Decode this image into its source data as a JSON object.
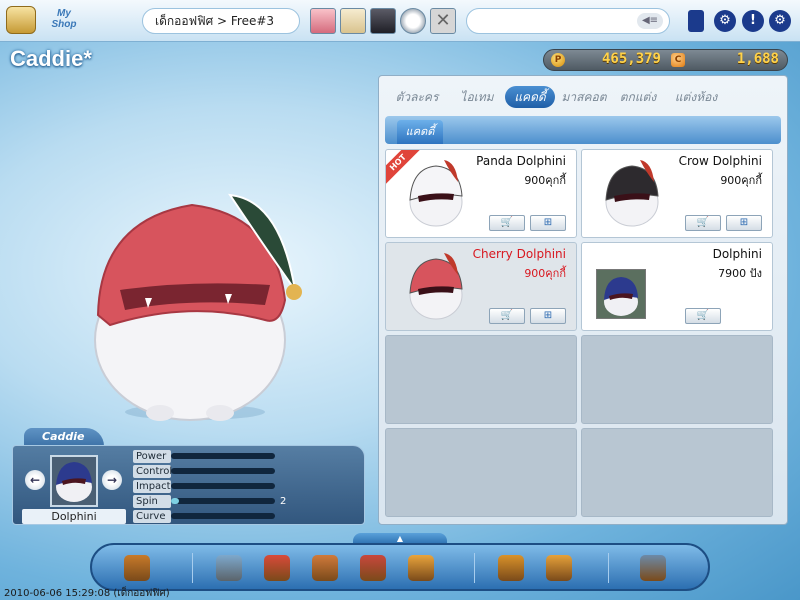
{
  "topbar": {
    "myshop_label": "My Shop",
    "room_name": "เด็กออฟฟิศ > Free#3",
    "close_glyph": "✕",
    "megaphone_glyph": "◀≡",
    "icons": [
      "inventory-icon",
      "settings-key-icon",
      "help-icon",
      "options-gear-icon"
    ],
    "help_glyph": "!",
    "gear_glyph": "⚙"
  },
  "page": {
    "title": "Caddie*"
  },
  "currency": {
    "pang": "465,379",
    "cookie": "1,688",
    "pang_glyph": "P",
    "cookie_glyph": "C"
  },
  "caddie_info": {
    "tab_label": "Caddie",
    "selected_name": "Dolphini",
    "prev_glyph": "←",
    "next_glyph": "→",
    "stats": [
      {
        "label": "Power",
        "value": "",
        "fill": 0
      },
      {
        "label": "Control",
        "value": "",
        "fill": 0
      },
      {
        "label": "Impact",
        "value": "",
        "fill": 0
      },
      {
        "label": "Spin",
        "value": "2",
        "fill": 0.08
      },
      {
        "label": "Curve",
        "value": "",
        "fill": 0
      }
    ]
  },
  "shop": {
    "tabs": [
      "ตัวละคร",
      "ไอเทม",
      "แคดดี้",
      "มาสคอต",
      "ตกแต่ง",
      "แต่งห้อง"
    ],
    "active_tab": 2,
    "subtab": "แคดดี้",
    "cart_glyph": "🛒",
    "gift_glyph": "⊞",
    "items": [
      {
        "name": "Panda Dolphini",
        "price": "900คุกกี้",
        "hot": true,
        "hot_label": "HOT",
        "gift": true
      },
      {
        "name": "Crow Dolphini",
        "price": "900คุกกี้",
        "hot": false,
        "gift": true
      },
      {
        "name": "Cherry Dolphini",
        "price": "900คุกกี้",
        "hot": false,
        "gift": true,
        "selected": true
      },
      {
        "name": "Dolphini",
        "price": "7900 ปัง",
        "hot": false,
        "gift": false
      }
    ]
  },
  "toolbar": {
    "expand_glyph": "▲",
    "tools": [
      "exit-door-icon",
      "shop-register-icon",
      "gift-box-icon",
      "card-pack-icon",
      "mailbox-icon",
      "cookie-icon",
      "home-icon",
      "exchange-icon",
      "settings-panel-icon"
    ]
  },
  "status": {
    "timestamp": "2010-06-06 15:29:08 (เด็กออฟฟิศ)"
  },
  "colors": {
    "accent": "#1f5fa7",
    "selected_price": "#d8171f",
    "gold": "#ffd24a"
  }
}
